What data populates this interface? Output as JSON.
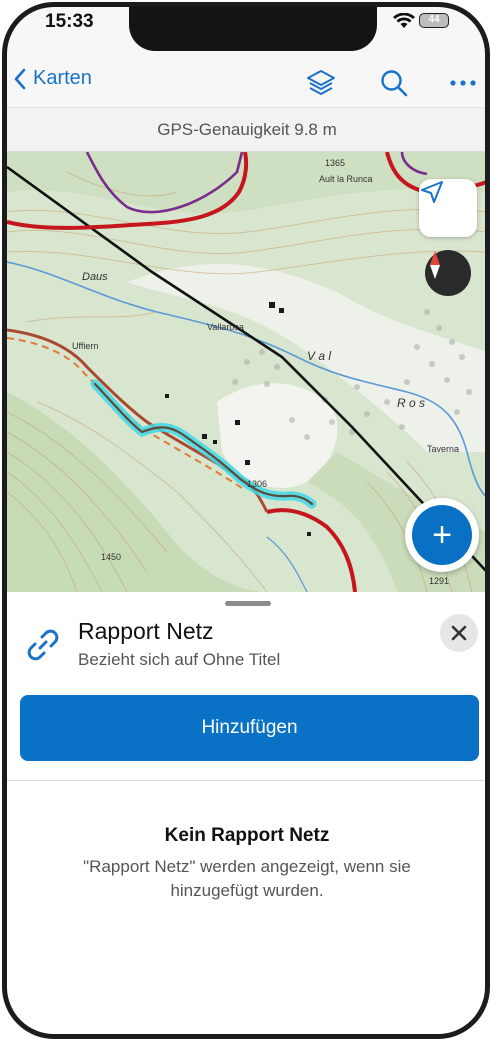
{
  "status_bar": {
    "time": "15:33",
    "battery": "44"
  },
  "nav": {
    "back_label": "Karten",
    "icons": [
      "layers-icon",
      "search-icon",
      "more-icon"
    ]
  },
  "gps": {
    "accuracy_text": "GPS-Genauigkeit 9.8 m"
  },
  "map": {
    "labels": [
      "1365",
      "Ault la Runca",
      "Uffiern",
      "Vallarosa",
      "Daus",
      "V a l",
      "R o s",
      "Taverna",
      "1306",
      "1450",
      "1291"
    ],
    "controls": {
      "locate": "location-arrow-icon",
      "compass": "compass-icon",
      "add": "+"
    }
  },
  "sheet": {
    "title": "Rapport Netz",
    "subtitle": "Bezieht sich auf Ohne Titel",
    "add_button": "Hinzufügen",
    "empty_title": "Kein Rapport Netz",
    "empty_text": "\"Rapport Netz\" werden angezeigt, wenn sie hinzugefügt wurden."
  },
  "colors": {
    "accent": "#0a72c6",
    "highlight_track": "#3fd7e6",
    "road": "#c4161c"
  }
}
